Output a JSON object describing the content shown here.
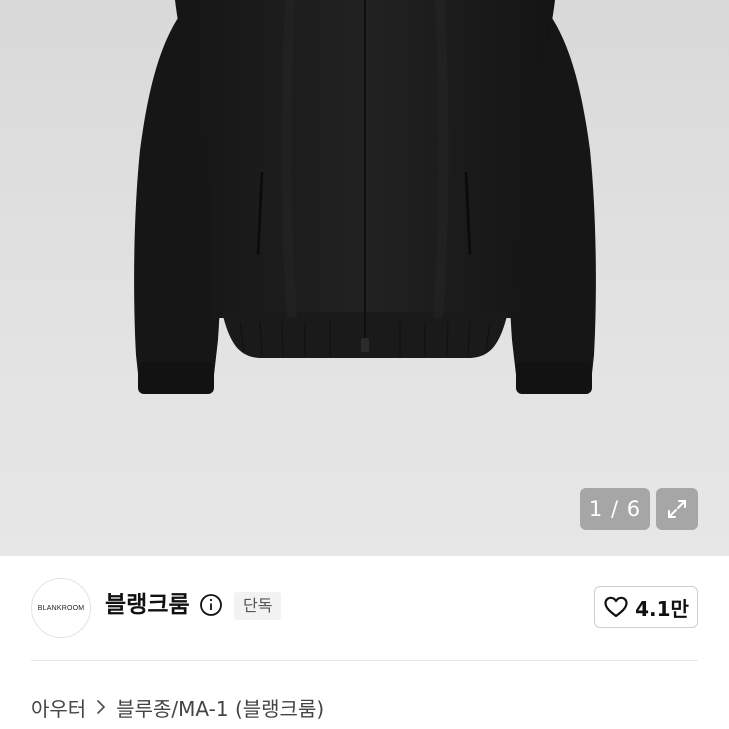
{
  "gallery": {
    "current": 1,
    "total": 6,
    "counter_text": "1 / 6",
    "expand_icon": "expand-icon",
    "background_color": "#e2e2e2",
    "product_color": "#1c1c1c"
  },
  "brand": {
    "logo_text": "BLANKROOM",
    "name": "블랭크룸",
    "info_icon": "info-icon",
    "badge": "단독"
  },
  "like": {
    "icon": "heart-outline-icon",
    "count": "4.1만"
  },
  "breadcrumb": {
    "items": [
      "아우터",
      "블루종/MA-1 (블랭크룸)"
    ],
    "separator_icon": "chevron-right-icon"
  },
  "colors": {
    "text_primary": "#111111",
    "text_secondary": "#444444",
    "badge_bg": "#f2f2f2",
    "border": "#cfcfcf"
  }
}
